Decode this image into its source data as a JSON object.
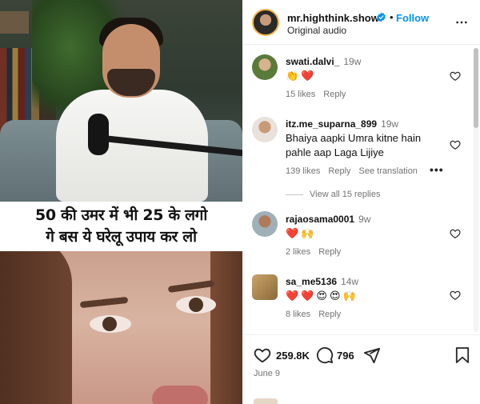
{
  "media": {
    "caption_line1": "50 की उमर में भी 25 के लगो",
    "caption_line2": "गे बस ये घरेलू उपाय कर लो"
  },
  "header": {
    "username": "mr.highthink.show",
    "separator": "•",
    "follow_label": "Follow",
    "audio": "Original audio"
  },
  "comments": [
    {
      "user": "swati.dalvi_",
      "time": "19w",
      "text": "",
      "emojis": [
        "👏",
        "❤️"
      ],
      "likes": "15 likes",
      "reply": "Reply",
      "translate": ""
    },
    {
      "user": "itz.me_suparna_899",
      "time": "19w",
      "text": "Bhaiya aapki Umra kitne hain pahle aap Laga Lijiye",
      "emojis": [],
      "likes": "139 likes",
      "reply": "Reply",
      "translate": "See translation"
    },
    {
      "user": "rajaosama0001",
      "time": "9w",
      "text": "",
      "emojis": [
        "❤️",
        "🙌"
      ],
      "likes": "2 likes",
      "reply": "Reply",
      "translate": ""
    },
    {
      "user": "sa_me5136",
      "time": "14w",
      "text": "",
      "emojis": [
        "❤️",
        "❤️",
        "😍",
        "😍",
        "🙌"
      ],
      "likes": "8 likes",
      "reply": "Reply",
      "translate": ""
    }
  ],
  "view_replies": "View all 15 replies",
  "actions": {
    "like_count": "259.8K",
    "comment_count": "796"
  },
  "date": "June 9",
  "colors": {
    "accent": "#0095f6",
    "heart": "#ed4956",
    "muted": "#737373"
  }
}
